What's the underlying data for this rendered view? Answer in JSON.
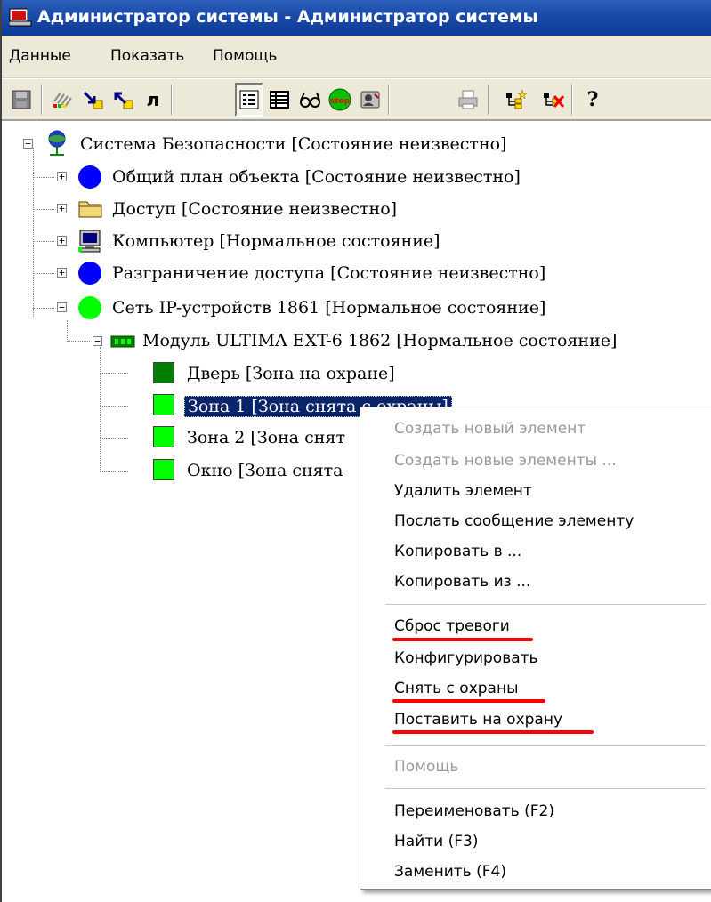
{
  "window": {
    "title": "Администратор системы - Администратор системы"
  },
  "menubar": {
    "items": [
      "Данные",
      "Показать",
      "Помощь"
    ]
  },
  "toolbar": {
    "buttons": [
      "save-icon",
      "grid-icon",
      "arrow-in-icon",
      "arrow-out-icon",
      "lambda-icon",
      "list-view-icon",
      "table-view-icon",
      "glasses-icon",
      "stop-icon",
      "user-card-icon",
      "print-icon",
      "add-element-icon",
      "delete-element-icon",
      "help-icon"
    ],
    "lambda_glyph": "л",
    "help_glyph": "?",
    "stop_text": "stop"
  },
  "tree": {
    "root": "Система Безопасности [Состояние неизвестно]",
    "n1": "Общий план объекта [Состояние неизвестно]",
    "n2": "Доступ [Состояние неизвестно]",
    "n3": "Компьютер [Нормальное состояние]",
    "n4": "Разграничение доступа [Состояние неизвестно]",
    "n5": "Сеть IP-устройств 1861 [Нормальное состояние]",
    "n6": "Модуль ULTIMA EXT-6 1862 [Нормальное состояние]",
    "z1": "Дверь [Зона на охране]",
    "z2": "Зона 1 [Зона снята с охраны]",
    "z3": "Зона 2 [Зона снят",
    "z4": "Окно [Зона снята"
  },
  "context_menu": {
    "create_new": "Создать новый элемент",
    "create_many": "Создать новые элементы ...",
    "delete": "Удалить элемент",
    "send_message": "Послать сообщение элементу",
    "copy_to": "Копировать в ...",
    "copy_from": "Копировать из ...",
    "reset_alarm": "Сброс тревоги",
    "configure": "Конфигурировать",
    "disarm": "Снять с охраны",
    "arm": "Поставить на охрану",
    "help": "Помощь",
    "rename": "Переименовать (F2)",
    "find": "Найти (F3)",
    "replace": "Заменить (F4)"
  },
  "colors": {
    "unknown_state": "#0000ff",
    "normal_state": "#00ff00",
    "armed_zone": "#008000",
    "disarmed_zone": "#00ff00",
    "highlight_underline": "#ff0000",
    "selection": "#0a246a"
  }
}
